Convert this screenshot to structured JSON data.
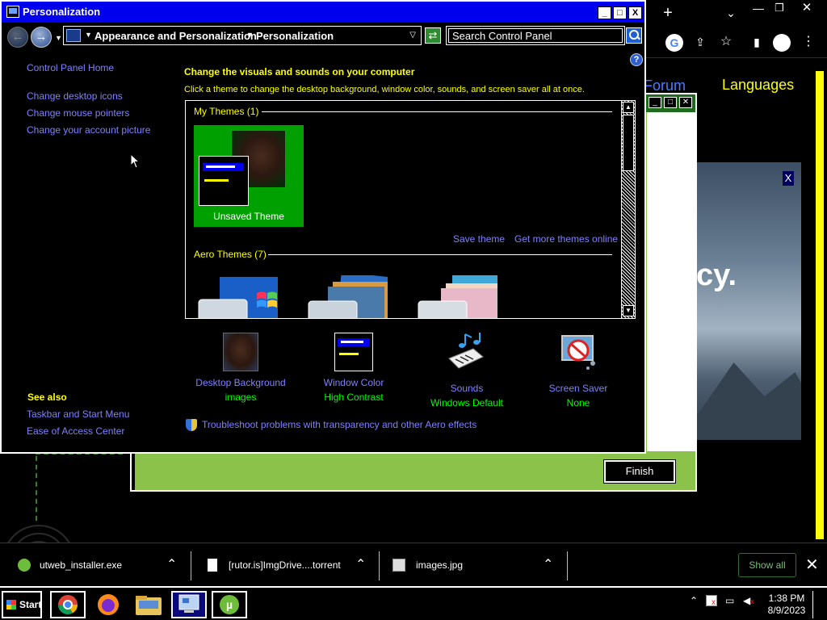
{
  "window": {
    "title": "Personalization",
    "minimize": "_",
    "maximize": "□",
    "close": "X"
  },
  "navbar": {
    "breadcrumb": [
      "Appearance and Personalization",
      "Personalization"
    ],
    "search_placeholder": "Search Control Panel"
  },
  "left_pane": {
    "home": "Control Panel Home",
    "links": [
      "Change desktop icons",
      "Change mouse pointers",
      "Change your account picture"
    ],
    "see_also_heading": "See also",
    "see_also": [
      "Taskbar and Start Menu",
      "Ease of Access Center"
    ]
  },
  "main": {
    "heading": "Change the visuals and sounds on your computer",
    "subtitle": "Click a theme to change the desktop background, window color, sounds, and screen saver all at once.",
    "my_themes_header": "My Themes (1)",
    "unsaved_theme_label": "Unsaved Theme",
    "save_theme": "Save theme",
    "more_themes": "Get more themes online",
    "aero_themes_header": "Aero Themes (7)"
  },
  "settings": [
    {
      "name": "Desktop Background",
      "value": "images",
      "icon": "photo-icon"
    },
    {
      "name": "Window Color",
      "value": "High Contrast",
      "icon": "window-color-icon"
    },
    {
      "name": "Sounds",
      "value": "Windows Default",
      "icon": "music-notes-icon"
    },
    {
      "name": "Screen Saver",
      "value": "None",
      "icon": "screen-saver-icon"
    }
  ],
  "troubleshoot": "Troubleshoot problems with transparency and other Aero effects",
  "installer": {
    "finish": "Finish"
  },
  "browser": {
    "links": [
      "Forum",
      "Languages"
    ],
    "ad_text": "cy.",
    "ad_close": "X"
  },
  "downloads": [
    {
      "name": "utweb_installer.exe",
      "icon": "utorrent-icon"
    },
    {
      "name": "[rutor.is]ImgDrive....torrent",
      "icon": "file-icon"
    },
    {
      "name": "images.jpg",
      "icon": "image-file-icon"
    }
  ],
  "downloads_show_all": "Show all",
  "taskbar": {
    "start": "Start",
    "time": "1:38 PM",
    "date": "8/9/2023"
  },
  "colors": {
    "title_bar": "#0000ee",
    "link": "#8080ff",
    "heading": "#ffff00",
    "value": "#00ff00",
    "tile": "#00a000",
    "installer": "#8bc34a"
  }
}
